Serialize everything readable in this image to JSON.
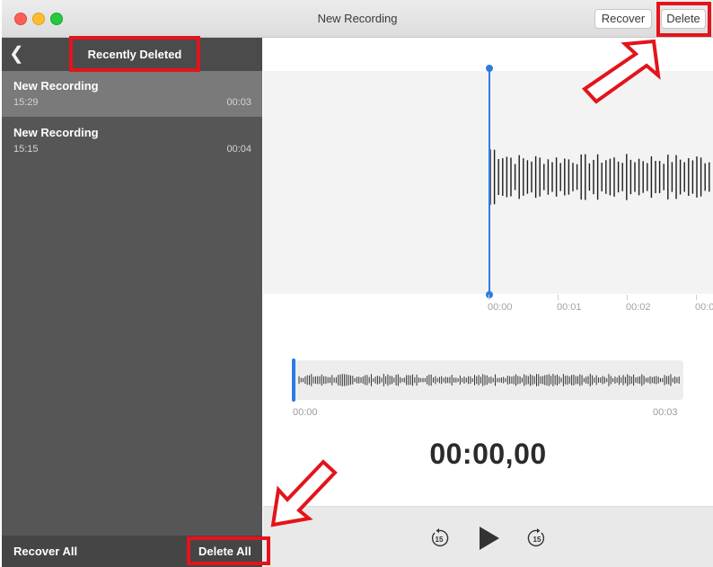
{
  "window": {
    "title": "New Recording"
  },
  "toolbar": {
    "recover_label": "Recover",
    "delete_label": "Delete"
  },
  "sidebar": {
    "title": "Recently Deleted",
    "items": [
      {
        "name": "New Recording",
        "time": "15:29",
        "duration": "00:03",
        "selected": true
      },
      {
        "name": "New Recording",
        "time": "15:15",
        "duration": "00:04",
        "selected": false
      }
    ],
    "footer": {
      "recover_all_label": "Recover All",
      "delete_all_label": "Delete All"
    }
  },
  "waveform": {
    "ruler_labels": [
      "00:00",
      "00:01",
      "00:02",
      "00:0"
    ]
  },
  "overview": {
    "start_label": "00:00",
    "end_label": "00:03"
  },
  "player": {
    "timer": "00:00,00",
    "skip_back_seconds": "15",
    "skip_forward_seconds": "15"
  },
  "colors": {
    "accent": "#2d7be4",
    "highlight": "#e3141b",
    "sidebar": "#565656"
  }
}
